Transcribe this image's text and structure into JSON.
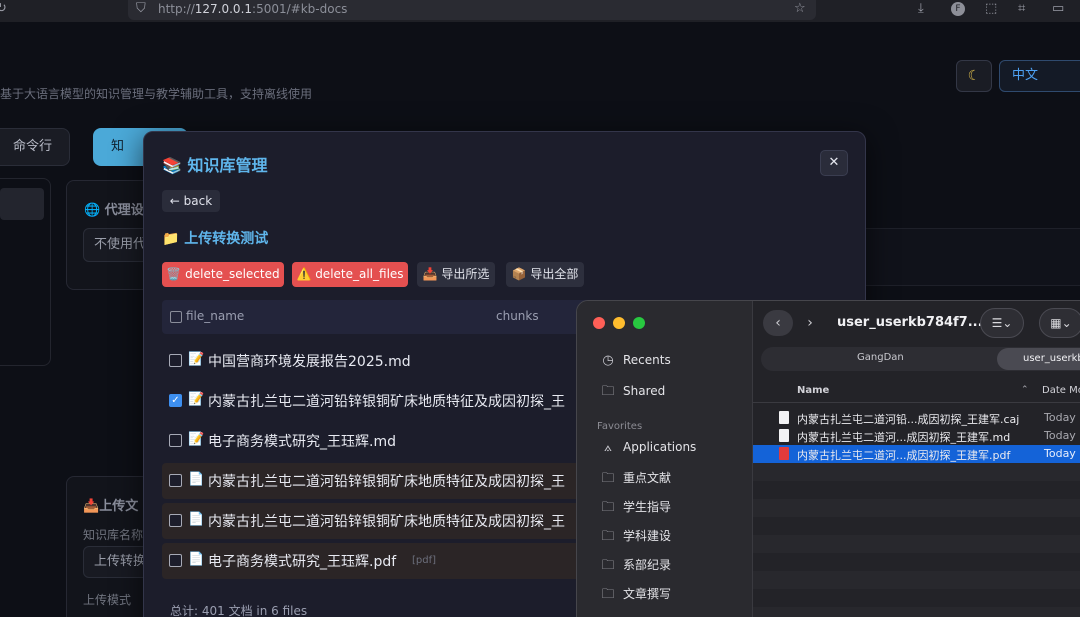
{
  "browser": {
    "url_prefix": "http://",
    "url_host": "127.0.0.1",
    "url_rest": ":5001/#kb-docs"
  },
  "app": {
    "subtitle": "基于大语言模型的知识管理与教学辅助工具，支持离线使用",
    "language": "中文",
    "tabs": {
      "cmd": "命令行",
      "kb": "知"
    },
    "proxy_title": "代理设",
    "proxy_value": "不使用代",
    "upload_title": "上传文",
    "kb_name_label": "知识库名称",
    "kb_name_value": "上传转换",
    "upload_mode_label": "上传模式"
  },
  "modal": {
    "title": "📚 知识库管理",
    "back": "← back",
    "kb_name": "📁 上传转换测试",
    "buttons": {
      "delete_selected": "🗑️ delete_selected",
      "delete_all": "⚠️ delete_all_files",
      "export_selected": "📥 导出所选",
      "export_all": "📦 导出全部"
    },
    "columns": {
      "file_name": "file_name",
      "chunks": "chunks"
    },
    "files": [
      {
        "icon": "📝",
        "name": "中国营商环境发展报告2025.md",
        "checked": false,
        "tag": ""
      },
      {
        "icon": "📝",
        "name": "内蒙古扎兰屯二道河铅锌银铜矿床地质特征及成因初探_王",
        "checked": true,
        "tag": ""
      },
      {
        "icon": "📝",
        "name": "电子商务模式研究_王珏辉.md",
        "checked": false,
        "tag": ""
      },
      {
        "icon": "📄",
        "name": "内蒙古扎兰屯二道河铅锌银铜矿床地质特征及成因初探_王",
        "checked": false,
        "tag": ""
      },
      {
        "icon": "📄",
        "name": "内蒙古扎兰屯二道河铅锌银铜矿床地质特征及成因初探_王",
        "checked": false,
        "tag": ""
      },
      {
        "icon": "📄",
        "name": "电子商务模式研究_王珏辉.pdf",
        "checked": false,
        "tag": "[pdf]"
      }
    ],
    "footer": "总计: 401 文档 in 6 files"
  },
  "finder": {
    "title": "user_userkb784f7...",
    "sidebar": {
      "recents": "Recents",
      "shared": "Shared",
      "favorites_header": "Favorites",
      "favorites": [
        "Applications",
        "重点文献",
        "学生指导",
        "学科建设",
        "系部纪录",
        "文章撰写"
      ]
    },
    "tabs": [
      "GangDan",
      "user_userkb"
    ],
    "columns": {
      "name": "Name",
      "date": "Date Mo"
    },
    "files": [
      {
        "name": "内蒙古扎兰屯二道河铅...成因初探_王建军.caj",
        "date": "Today",
        "type": "doc"
      },
      {
        "name": "内蒙古扎兰屯二道河...成因初探_王建军.md",
        "date": "Today",
        "type": "doc"
      },
      {
        "name": "内蒙古扎兰屯二道河...成因初探_王建军.pdf",
        "date": "Today",
        "type": "pdf"
      }
    ]
  }
}
